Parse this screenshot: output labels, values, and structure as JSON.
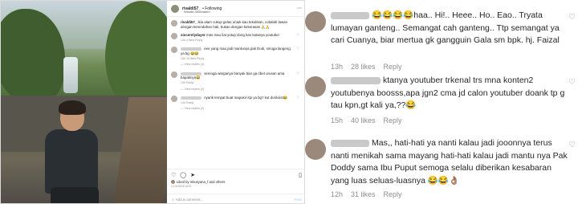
{
  "post": {
    "username": "rivaldi57_",
    "follow_label": "• Following",
    "location": "Wisata Sekuraden",
    "caption_user": "rivaldi57_",
    "caption": "ikia alam cukup gelas untuk kau tekukkan, cobalah lawan dengan kerendahan hati, bukan dengan kekerasan 🙏🙏",
    "comments": [
      {
        "user": "sincerelydayer",
        "text": "mas mau liat yutup dong kan katanya youtuber",
        "meta": "14h  4 likes  Reply",
        "replies": ""
      },
      {
        "user": "",
        "text": "eee yang mau jadi mantunya pak Dodi, smoga langeng ya bg 😂😂",
        "meta": "14h  10 likes  Reply",
        "replies": "— View replies (4)"
      },
      {
        "user": "",
        "text": "semoga warganya banyak biar ga ribet urusan ama bapaknya😂",
        "meta": "14h  Reply",
        "replies": "— View replies (2)"
      },
      {
        "user": "",
        "text": "nyarik tempat buat mapukir itpi ya bg? kut duriloiist😂",
        "meta": "14h  Reply",
        "replies": "— View replies (2)"
      }
    ],
    "likes_text": "Liked by mkusyana_f and others",
    "time_ago": "14 HOURS AGO",
    "add_comment_placeholder": "Add a comment...",
    "post_button": "Post"
  },
  "zoom": {
    "comments": [
      {
        "text": "😂😂😂😂haa.. Hi!.. Heee.. Ho.. Eao.. Tryata lumayan ganteng.. Semangat cah ganteng.. Ttp semangat ya cari Cuanya, biar mertua gk gangguin Gala sm bpk. hj. Faizal",
        "time": "13h",
        "likes": "28 likes",
        "reply": "Reply"
      },
      {
        "text": "ktanya youtuber trkenal trs mna konten2 youtubenya boosss,apa jgn2 cma jd calon youtuber doank tp g tau kpn,gt kali ya,??😂",
        "time": "15h",
        "likes": "40 likes",
        "reply": "Reply"
      },
      {
        "text": "Mas,, hati-hati ya nanti kalau jadi jooonnya terus nanti menikah sama mayang hati-hati kalau jadi mantu nya Pak Doddy sama Ibu Puput semoga selalu diberikan kesabaran yang luas seluas-luasnya 😂😂👌🏽",
        "time": "12h",
        "likes": "31 likes",
        "reply": "Reply"
      }
    ]
  }
}
